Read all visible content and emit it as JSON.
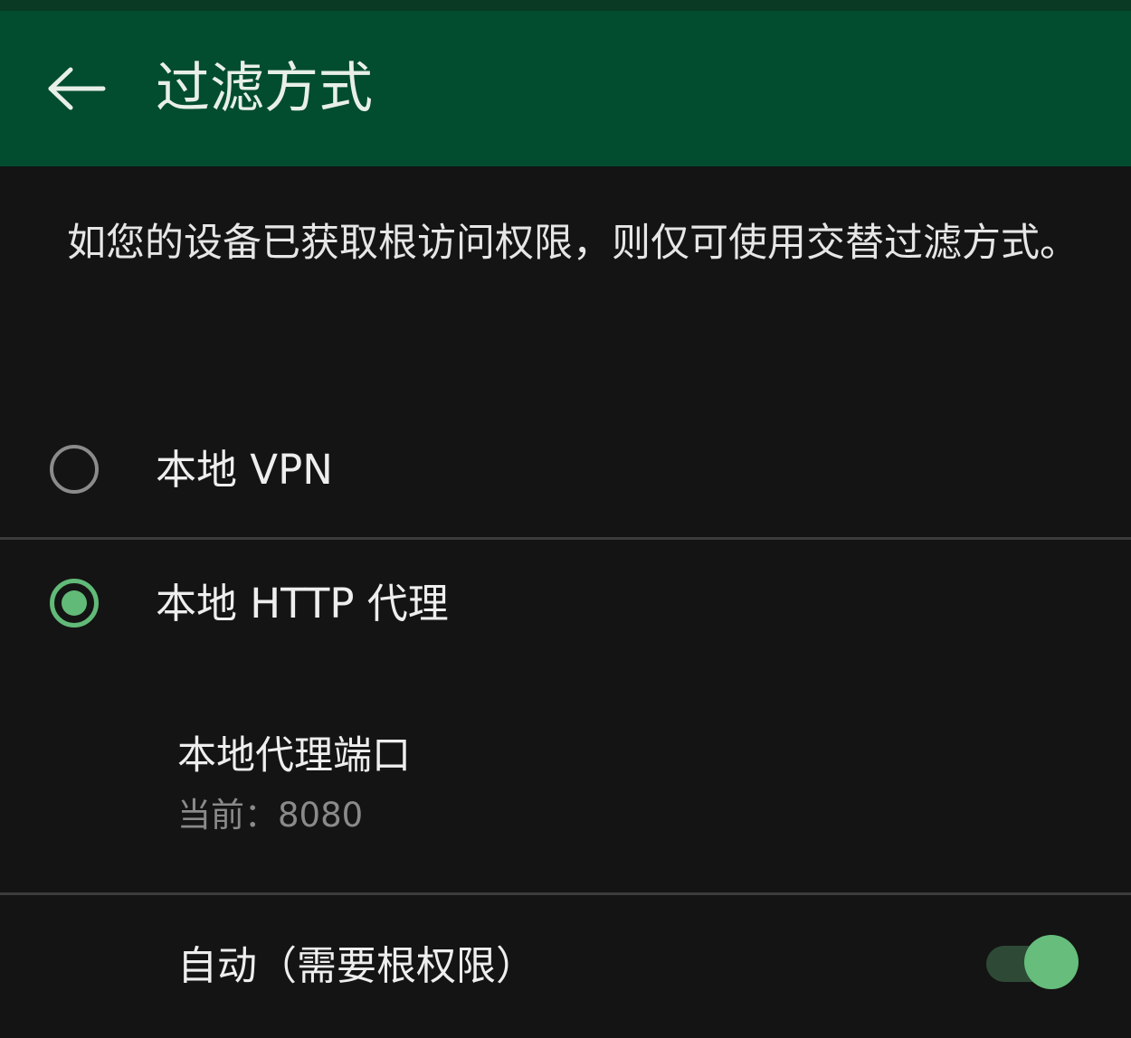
{
  "app_bar": {
    "title": "过滤方式",
    "back_icon": "arrow-left-icon"
  },
  "description": "如您的设备已获取根访问权限，则仅可使用交替过滤方式。",
  "filter_options": [
    {
      "label": "本地 VPN",
      "selected": false
    },
    {
      "label": "本地 HTTP 代理",
      "selected": true
    }
  ],
  "proxy_port": {
    "title": "本地代理端口",
    "summary": "当前：8080"
  },
  "auto_root": {
    "label": "自动（需要根权限）",
    "enabled": true
  },
  "colors": {
    "app_bar": "#024c30",
    "accent": "#62ba78",
    "background": "#141414"
  }
}
